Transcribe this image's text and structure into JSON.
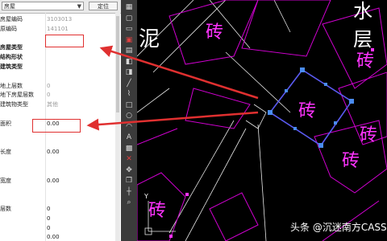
{
  "header": {
    "layer_value": "房屋",
    "locate_label": "定位"
  },
  "properties": [
    {
      "key": "房屋编码",
      "value": "3103013",
      "style": "gray"
    },
    {
      "key": "原编码",
      "value": "141101",
      "style": "gray"
    },
    {
      "key": "",
      "value": ""
    },
    {
      "key": "房屋类型",
      "value": "",
      "style": "bold"
    },
    {
      "key": "结构形状",
      "value": "",
      "style": "bold"
    },
    {
      "key": "建筑类型",
      "value": "",
      "style": "bold"
    },
    {
      "key": "",
      "value": ""
    },
    {
      "key": "地上层数",
      "value": "0",
      "style": "gray"
    },
    {
      "key": "地下房屋层数",
      "value": "0",
      "style": "gray"
    },
    {
      "key": "建筑物类型",
      "value": "其他",
      "style": "gray"
    },
    {
      "key": "",
      "value": ""
    },
    {
      "key": "面积",
      "value": "0.00"
    },
    {
      "key": "",
      "value": ""
    },
    {
      "key": "",
      "value": ""
    },
    {
      "key": "长度",
      "value": "0.00"
    },
    {
      "key": "",
      "value": ""
    },
    {
      "key": "",
      "value": ""
    },
    {
      "key": "宽度",
      "value": "0.00"
    },
    {
      "key": "",
      "value": ""
    },
    {
      "key": "",
      "value": ""
    },
    {
      "key": "层数",
      "value": "0"
    },
    {
      "key": "",
      "value": "0"
    },
    {
      "key": "",
      "value": "0"
    },
    {
      "key": "",
      "value": "0.00"
    }
  ],
  "toolbar_icons": [
    "table-icon",
    "new-icon",
    "open-icon",
    "save-icon",
    "print-icon",
    "layers-icon",
    "properties-icon",
    "line-icon",
    "polyline-icon",
    "rectangle-icon",
    "circle-icon",
    "arc-icon",
    "text-icon",
    "hatch-icon",
    "delete-icon",
    "move-icon",
    "copy-icon",
    "measure-icon",
    "zoom-icon"
  ],
  "canvas": {
    "labels": [
      {
        "text": "泥"
      },
      {
        "text": "水层"
      },
      {
        "text": "砖"
      },
      {
        "text": "砖"
      },
      {
        "text": "砖"
      },
      {
        "text": "砖"
      },
      {
        "text": "砖"
      },
      {
        "text": "砖"
      }
    ],
    "axis_label": "Y",
    "watermark": "头条 @沉迷南方CASS"
  },
  "colors": {
    "canvas_bg": "#000000",
    "building_outline": "#d000d0",
    "selected_outline": "#5a5af0",
    "label_magenta": "#ff33ff",
    "annotation_red": "#e03030"
  }
}
